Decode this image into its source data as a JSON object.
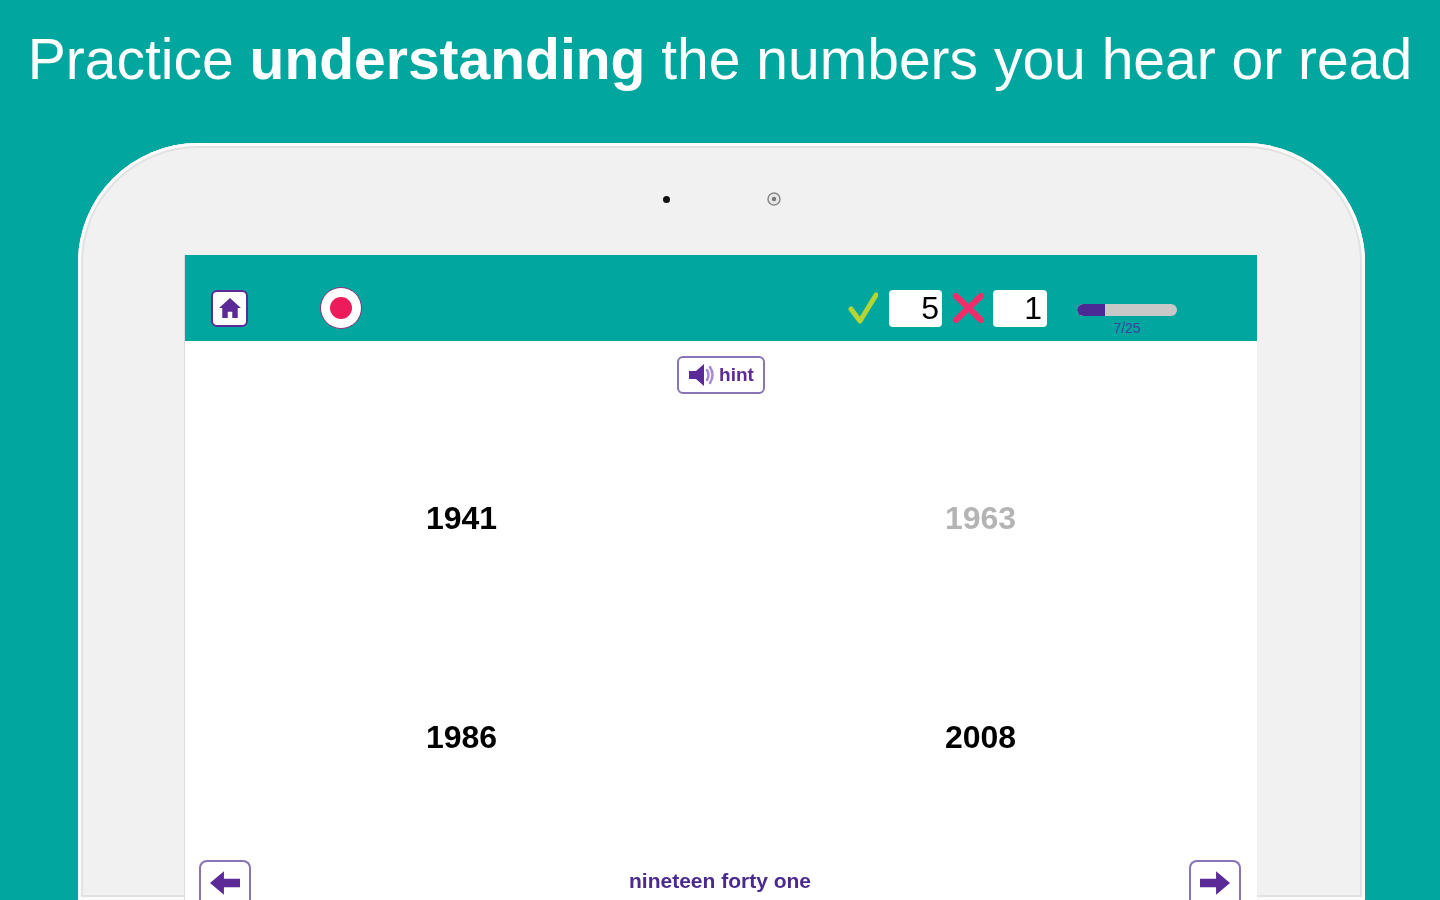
{
  "headline": "Practice **understanding** the numbers you hear or read",
  "toolbar": {
    "score_correct": "5",
    "score_wrong": "1",
    "progress": {
      "level": 0.28,
      "label": "7/25"
    }
  },
  "hint_button": {
    "label": "hint"
  },
  "options": [
    {
      "text": "1941",
      "disabled": false
    },
    {
      "text": "1963",
      "disabled": true
    },
    {
      "text": "1986",
      "disabled": false
    },
    {
      "text": "2008",
      "disabled": false
    }
  ],
  "prompt": "nineteen forty one"
}
